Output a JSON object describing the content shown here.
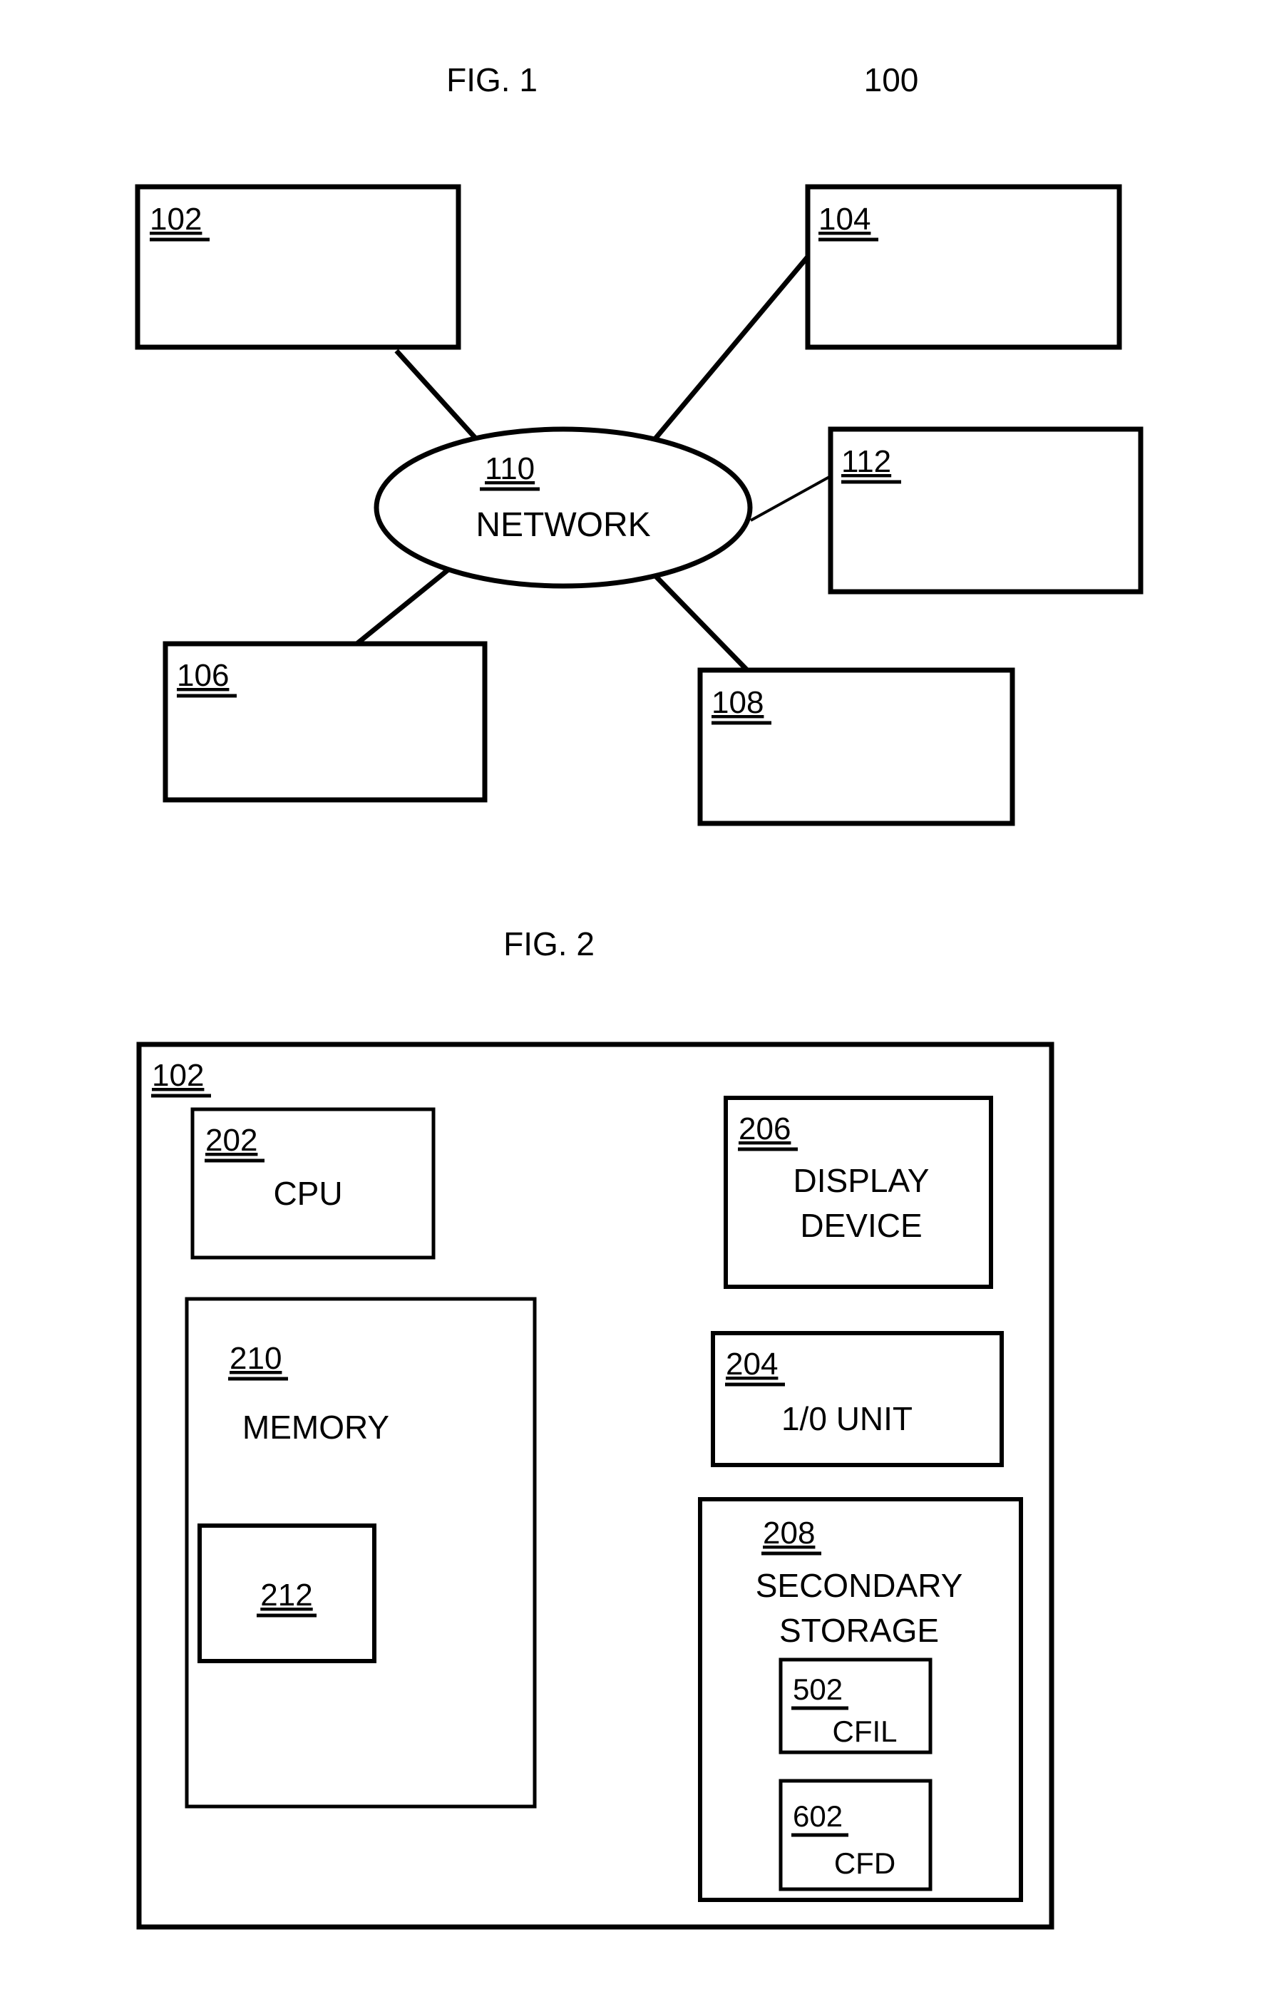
{
  "figures": [
    {
      "id": "fig1",
      "title": "FIG. 1",
      "system_number": "100",
      "type": "network-topology-diagram",
      "hub": {
        "ref": "110",
        "label": "NETWORK",
        "shape": "ellipse"
      },
      "nodes": [
        {
          "ref": "102",
          "label": "",
          "position": "top-left"
        },
        {
          "ref": "104",
          "label": "",
          "position": "top-right"
        },
        {
          "ref": "112",
          "label": "",
          "position": "middle-right"
        },
        {
          "ref": "106",
          "label": "",
          "position": "bottom-left"
        },
        {
          "ref": "108",
          "label": "",
          "position": "bottom-center-right"
        }
      ],
      "connections": [
        {
          "from": "102",
          "to": "110"
        },
        {
          "from": "104",
          "to": "110"
        },
        {
          "from": "112",
          "to": "110"
        },
        {
          "from": "106",
          "to": "110"
        },
        {
          "from": "108",
          "to": "110"
        }
      ]
    },
    {
      "id": "fig2",
      "title": "FIG. 2",
      "type": "block-diagram",
      "outer": {
        "ref": "102",
        "label": ""
      },
      "blocks": [
        {
          "ref": "202",
          "label": "CPU",
          "lines": [
            "CPU"
          ]
        },
        {
          "ref": "210",
          "label": "MEMORY",
          "lines": [
            "MEMORY"
          ]
        },
        {
          "ref": "212",
          "label": "",
          "lines": []
        },
        {
          "ref": "206",
          "label": "DISPLAY DEVICE",
          "lines": [
            "DISPLAY",
            "DEVICE"
          ]
        },
        {
          "ref": "204",
          "label": "1/0 UNIT",
          "lines": [
            "1/0 UNIT"
          ]
        },
        {
          "ref": "208",
          "label": "SECONDARY STORAGE",
          "lines": [
            "SECONDARY",
            "STORAGE"
          ]
        },
        {
          "ref": "502",
          "label": "CFIL",
          "lines": [
            "CFIL"
          ]
        },
        {
          "ref": "602",
          "label": "CFD",
          "lines": [
            "CFD"
          ]
        }
      ]
    }
  ],
  "colors": {
    "background": "#ffffff",
    "stroke": "#000000",
    "text": "#000000"
  }
}
